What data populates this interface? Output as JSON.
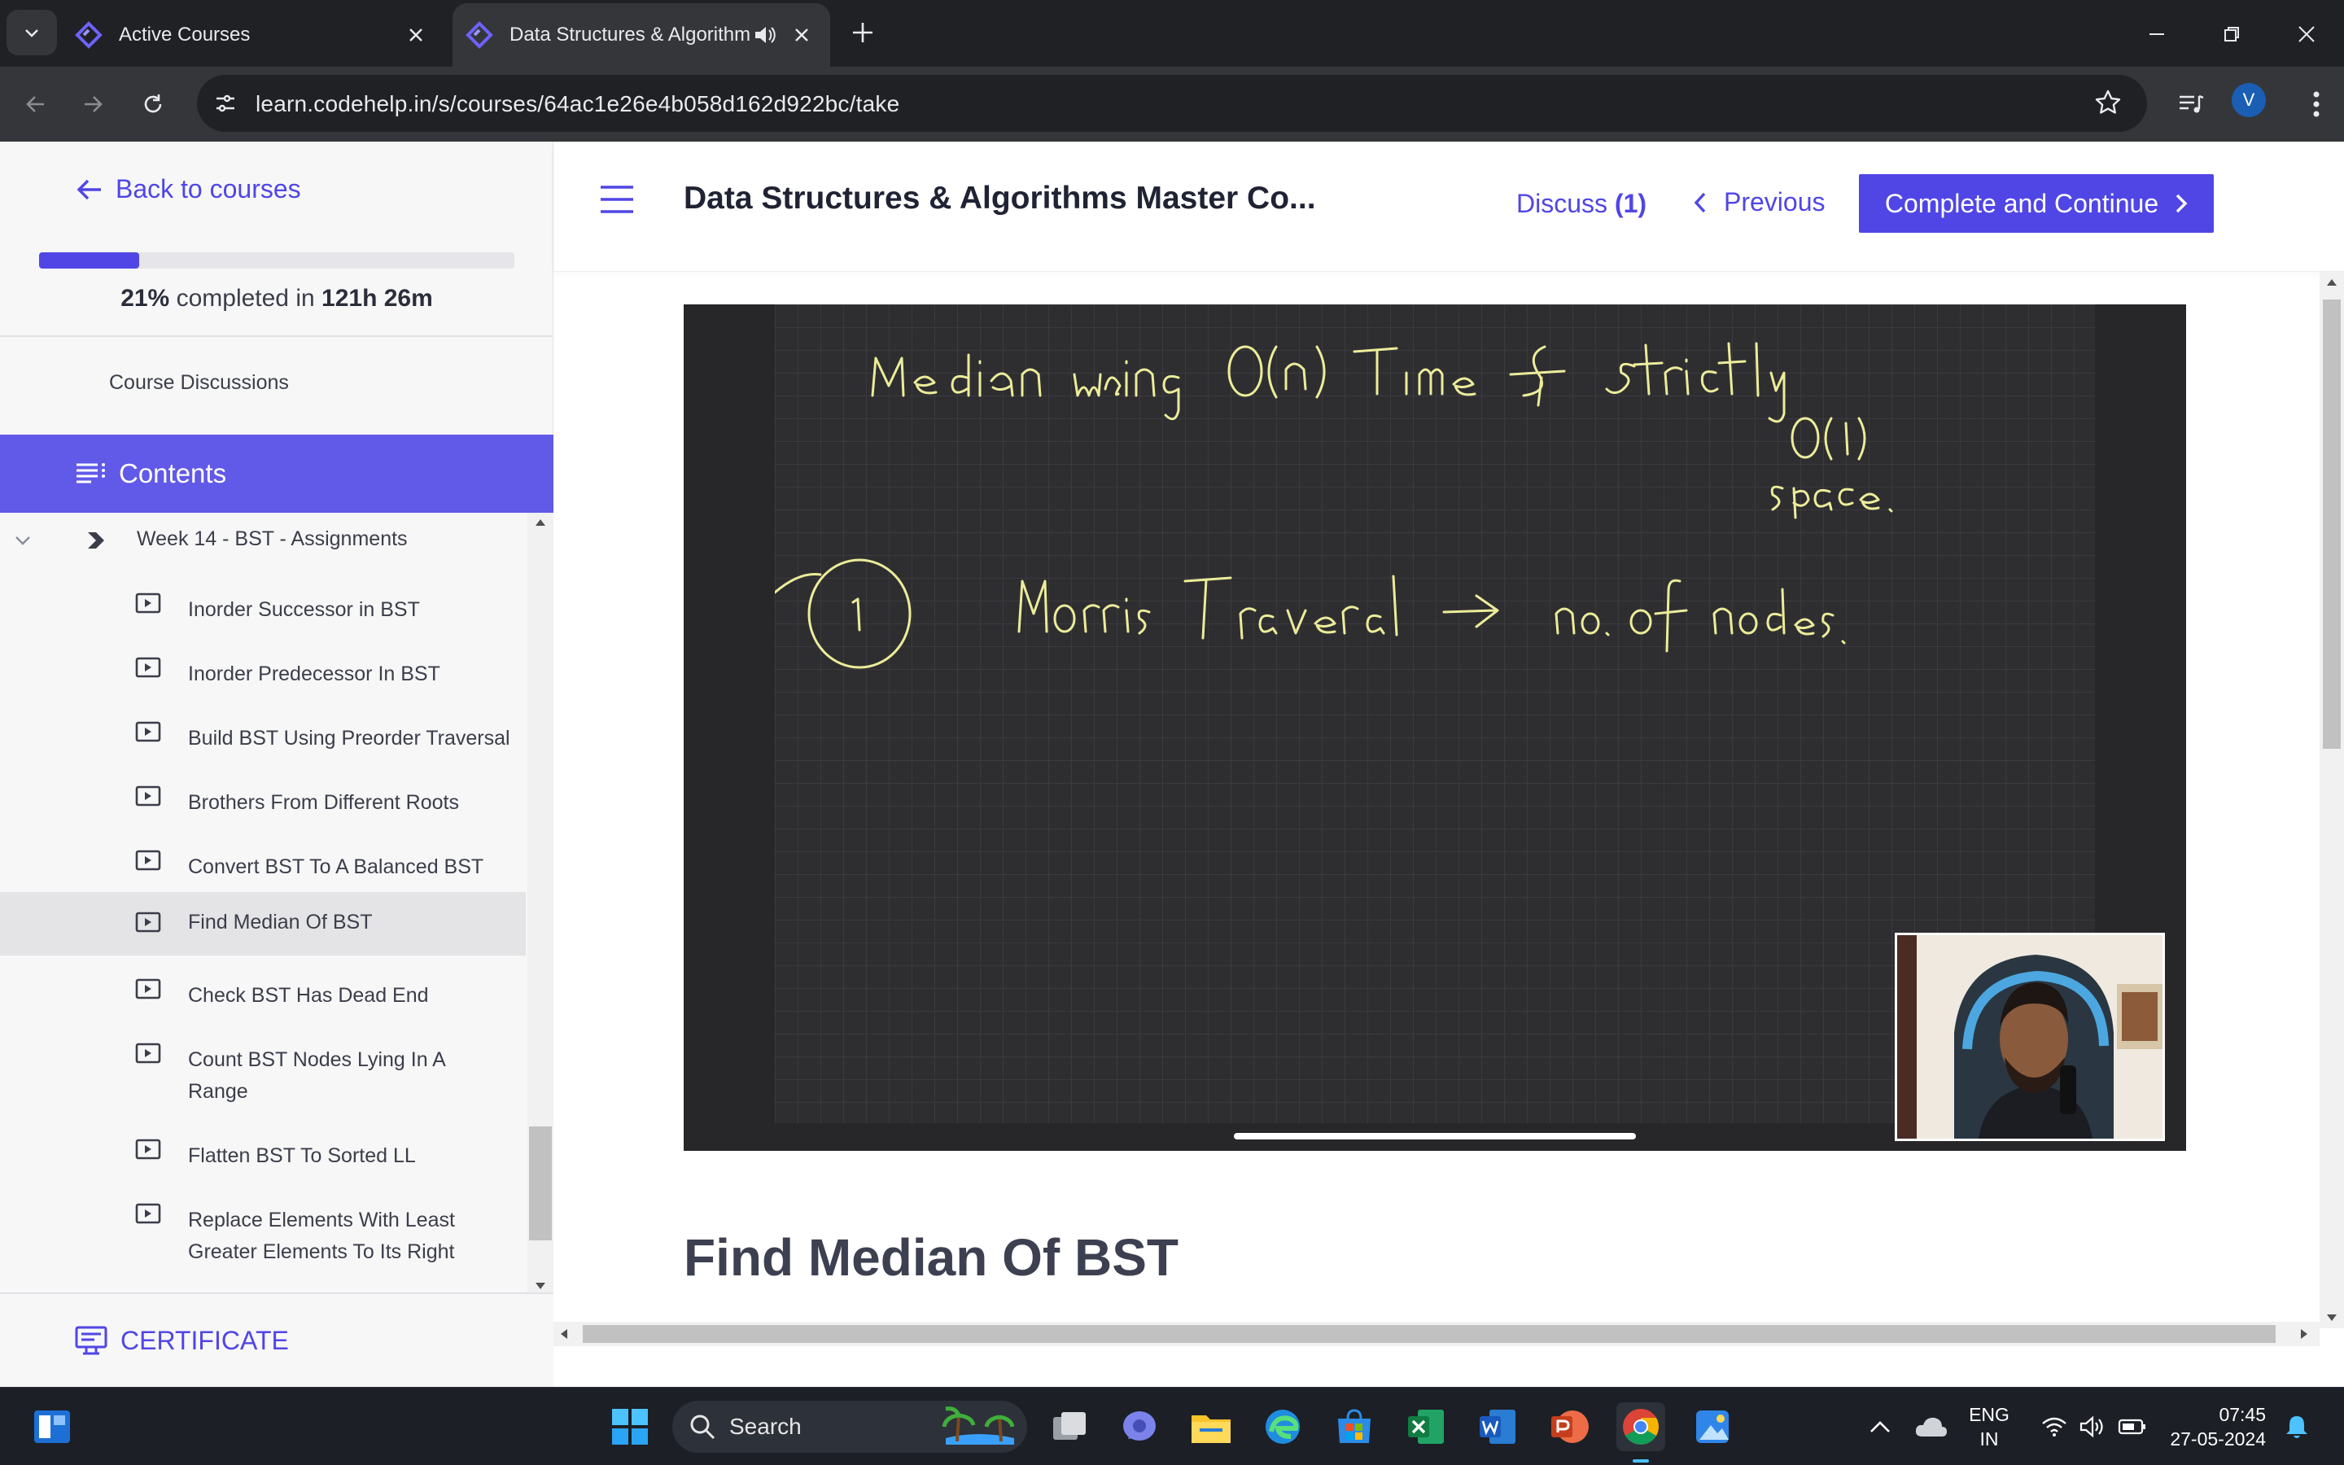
{
  "browser": {
    "tabs": [
      {
        "title": "Active Courses"
      },
      {
        "title": "Data Structures & Algorithms Master Course"
      }
    ],
    "url": "learn.codehelp.in/s/courses/64ac1e26e4b058d162d922bc/take",
    "profile_initial": "V"
  },
  "sidebar": {
    "back_label": "Back to courses",
    "progress": {
      "percent": 21,
      "percent_text": "21%",
      "middle_text": "completed in",
      "time_text": "121h 26m"
    },
    "discussions_label": "Course Discussions",
    "contents_label": "Contents",
    "section_title": "Week 14 - BST - Assignments",
    "lessons": [
      {
        "label": "Inorder Successor in BST"
      },
      {
        "label": "Inorder Predecessor In BST"
      },
      {
        "label": "Build BST Using Preorder Traversal"
      },
      {
        "label": "Brothers From Different Roots"
      },
      {
        "label": "Convert BST To A Balanced BST"
      },
      {
        "label": "Find Median Of BST"
      },
      {
        "label": "Check BST Has Dead End"
      },
      {
        "label": "Count BST Nodes Lying In A Range"
      },
      {
        "label": "Flatten BST To Sorted LL"
      },
      {
        "label": "Replace Elements With Least Greater Elements To Its Right"
      }
    ],
    "certificate_label": "CERTIFICATE"
  },
  "header": {
    "course_title": "Data Structures & Algorithms Master Co...",
    "discuss_label": "Discuss",
    "discuss_count": "(1)",
    "previous_label": "Previous",
    "complete_label": "Complete and Continue"
  },
  "lesson": {
    "title": "Find Median Of BST"
  },
  "taskbar": {
    "search_placeholder": "Search",
    "lang_line1": "ENG",
    "lang_line2": "IN",
    "time": "07:45",
    "date": "27-05-2024"
  },
  "colors": {
    "accent": "#5046e5",
    "contents_bar": "#6159e8",
    "chrome_dark": "#202124"
  }
}
